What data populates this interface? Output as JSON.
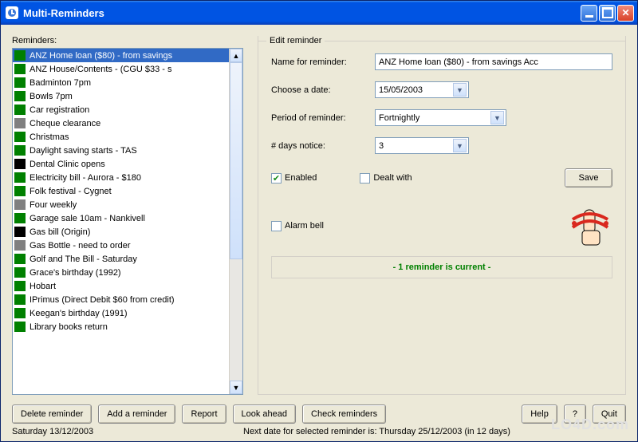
{
  "window": {
    "title": "Multi-Reminders"
  },
  "left_panel": {
    "label": "Reminders:",
    "items": [
      {
        "text": "ANZ Home loan ($80) - from savings",
        "color": "green",
        "selected": true
      },
      {
        "text": "ANZ House/Contents - (CGU $33 - s",
        "color": "green"
      },
      {
        "text": "Badminton 7pm",
        "color": "green"
      },
      {
        "text": "Bowls 7pm",
        "color": "green"
      },
      {
        "text": "Car registration",
        "color": "green"
      },
      {
        "text": "Cheque clearance",
        "color": "gray"
      },
      {
        "text": "Christmas",
        "color": "green"
      },
      {
        "text": "Daylight saving starts - TAS",
        "color": "green"
      },
      {
        "text": "Dental Clinic opens",
        "color": "black"
      },
      {
        "text": "Electricity bill - Aurora - $180",
        "color": "green"
      },
      {
        "text": "Folk festival - Cygnet",
        "color": "green"
      },
      {
        "text": "Four weekly",
        "color": "gray"
      },
      {
        "text": "Garage sale 10am - Nankivell",
        "color": "green"
      },
      {
        "text": "Gas bill (Origin)",
        "color": "black"
      },
      {
        "text": "Gas Bottle - need to order",
        "color": "gray"
      },
      {
        "text": "Golf and The Bill - Saturday",
        "color": "green"
      },
      {
        "text": "Grace's birthday (1992)",
        "color": "green"
      },
      {
        "text": "Hobart",
        "color": "green"
      },
      {
        "text": "IPrimus (Direct Debit $60 from credit)",
        "color": "green"
      },
      {
        "text": "Keegan's birthday (1991)",
        "color": "green"
      },
      {
        "text": "Library books return",
        "color": "green"
      }
    ]
  },
  "edit": {
    "group_title": "Edit reminder",
    "name_label": "Name for reminder:",
    "name_value": "ANZ Home loan ($80) - from savings Acc",
    "date_label": "Choose a date:",
    "date_value": "15/05/2003",
    "period_label": "Period of reminder:",
    "period_value": "Fortnightly",
    "days_label": "# days notice:",
    "days_value": "3",
    "enabled_label": "Enabled",
    "enabled_checked": true,
    "dealt_label": "Dealt with",
    "dealt_checked": false,
    "save_label": "Save",
    "alarm_label": "Alarm bell",
    "alarm_checked": false,
    "status_text": "- 1 reminder is current -"
  },
  "buttons": {
    "delete": "Delete reminder",
    "add": "Add a reminder",
    "report": "Report",
    "look_ahead": "Look ahead",
    "check": "Check reminders",
    "help": "Help",
    "qmark": "?",
    "quit": "Quit"
  },
  "status": {
    "date": "Saturday   13/12/2003",
    "next": "Next date for selected reminder is: Thursday 25/12/2003 (in 12 days)"
  },
  "watermark": "LO4D.com"
}
